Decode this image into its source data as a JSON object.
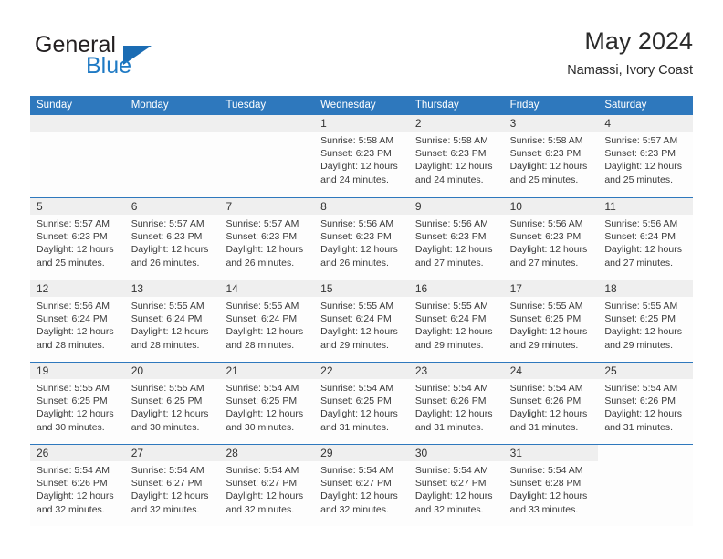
{
  "logo": {
    "word_top": "General",
    "word_bottom": "Blue",
    "triangle_icon": "triangle-icon",
    "color_dark": "#231f20",
    "color_blue": "#1f7ac4",
    "triangle_color": "#1b6cb3"
  },
  "header": {
    "title": "May 2024",
    "subtitle": "Namassi, Ivory Coast"
  },
  "theme": {
    "header_bar": "#2e78bd",
    "day_band": "#efefef",
    "row_divider": "#2e78bd",
    "text": "#3a3a3a"
  },
  "weekdays": [
    "Sunday",
    "Monday",
    "Tuesday",
    "Wednesday",
    "Thursday",
    "Friday",
    "Saturday"
  ],
  "weeks": [
    [
      {
        "day": "",
        "blank": false,
        "lines": []
      },
      {
        "day": "",
        "blank": false,
        "lines": []
      },
      {
        "day": "",
        "blank": false,
        "lines": []
      },
      {
        "day": "1",
        "blank": false,
        "lines": [
          "Sunrise: 5:58 AM",
          "Sunset: 6:23 PM",
          "Daylight: 12 hours",
          "and 24 minutes."
        ]
      },
      {
        "day": "2",
        "blank": false,
        "lines": [
          "Sunrise: 5:58 AM",
          "Sunset: 6:23 PM",
          "Daylight: 12 hours",
          "and 24 minutes."
        ]
      },
      {
        "day": "3",
        "blank": false,
        "lines": [
          "Sunrise: 5:58 AM",
          "Sunset: 6:23 PM",
          "Daylight: 12 hours",
          "and 25 minutes."
        ]
      },
      {
        "day": "4",
        "blank": false,
        "lines": [
          "Sunrise: 5:57 AM",
          "Sunset: 6:23 PM",
          "Daylight: 12 hours",
          "and 25 minutes."
        ]
      }
    ],
    [
      {
        "day": "5",
        "blank": false,
        "lines": [
          "Sunrise: 5:57 AM",
          "Sunset: 6:23 PM",
          "Daylight: 12 hours",
          "and 25 minutes."
        ]
      },
      {
        "day": "6",
        "blank": false,
        "lines": [
          "Sunrise: 5:57 AM",
          "Sunset: 6:23 PM",
          "Daylight: 12 hours",
          "and 26 minutes."
        ]
      },
      {
        "day": "7",
        "blank": false,
        "lines": [
          "Sunrise: 5:57 AM",
          "Sunset: 6:23 PM",
          "Daylight: 12 hours",
          "and 26 minutes."
        ]
      },
      {
        "day": "8",
        "blank": false,
        "lines": [
          "Sunrise: 5:56 AM",
          "Sunset: 6:23 PM",
          "Daylight: 12 hours",
          "and 26 minutes."
        ]
      },
      {
        "day": "9",
        "blank": false,
        "lines": [
          "Sunrise: 5:56 AM",
          "Sunset: 6:23 PM",
          "Daylight: 12 hours",
          "and 27 minutes."
        ]
      },
      {
        "day": "10",
        "blank": false,
        "lines": [
          "Sunrise: 5:56 AM",
          "Sunset: 6:23 PM",
          "Daylight: 12 hours",
          "and 27 minutes."
        ]
      },
      {
        "day": "11",
        "blank": false,
        "lines": [
          "Sunrise: 5:56 AM",
          "Sunset: 6:24 PM",
          "Daylight: 12 hours",
          "and 27 minutes."
        ]
      }
    ],
    [
      {
        "day": "12",
        "blank": false,
        "lines": [
          "Sunrise: 5:56 AM",
          "Sunset: 6:24 PM",
          "Daylight: 12 hours",
          "and 28 minutes."
        ]
      },
      {
        "day": "13",
        "blank": false,
        "lines": [
          "Sunrise: 5:55 AM",
          "Sunset: 6:24 PM",
          "Daylight: 12 hours",
          "and 28 minutes."
        ]
      },
      {
        "day": "14",
        "blank": false,
        "lines": [
          "Sunrise: 5:55 AM",
          "Sunset: 6:24 PM",
          "Daylight: 12 hours",
          "and 28 minutes."
        ]
      },
      {
        "day": "15",
        "blank": false,
        "lines": [
          "Sunrise: 5:55 AM",
          "Sunset: 6:24 PM",
          "Daylight: 12 hours",
          "and 29 minutes."
        ]
      },
      {
        "day": "16",
        "blank": false,
        "lines": [
          "Sunrise: 5:55 AM",
          "Sunset: 6:24 PM",
          "Daylight: 12 hours",
          "and 29 minutes."
        ]
      },
      {
        "day": "17",
        "blank": false,
        "lines": [
          "Sunrise: 5:55 AM",
          "Sunset: 6:25 PM",
          "Daylight: 12 hours",
          "and 29 minutes."
        ]
      },
      {
        "day": "18",
        "blank": false,
        "lines": [
          "Sunrise: 5:55 AM",
          "Sunset: 6:25 PM",
          "Daylight: 12 hours",
          "and 29 minutes."
        ]
      }
    ],
    [
      {
        "day": "19",
        "blank": false,
        "lines": [
          "Sunrise: 5:55 AM",
          "Sunset: 6:25 PM",
          "Daylight: 12 hours",
          "and 30 minutes."
        ]
      },
      {
        "day": "20",
        "blank": false,
        "lines": [
          "Sunrise: 5:55 AM",
          "Sunset: 6:25 PM",
          "Daylight: 12 hours",
          "and 30 minutes."
        ]
      },
      {
        "day": "21",
        "blank": false,
        "lines": [
          "Sunrise: 5:54 AM",
          "Sunset: 6:25 PM",
          "Daylight: 12 hours",
          "and 30 minutes."
        ]
      },
      {
        "day": "22",
        "blank": false,
        "lines": [
          "Sunrise: 5:54 AM",
          "Sunset: 6:25 PM",
          "Daylight: 12 hours",
          "and 31 minutes."
        ]
      },
      {
        "day": "23",
        "blank": false,
        "lines": [
          "Sunrise: 5:54 AM",
          "Sunset: 6:26 PM",
          "Daylight: 12 hours",
          "and 31 minutes."
        ]
      },
      {
        "day": "24",
        "blank": false,
        "lines": [
          "Sunrise: 5:54 AM",
          "Sunset: 6:26 PM",
          "Daylight: 12 hours",
          "and 31 minutes."
        ]
      },
      {
        "day": "25",
        "blank": false,
        "lines": [
          "Sunrise: 5:54 AM",
          "Sunset: 6:26 PM",
          "Daylight: 12 hours",
          "and 31 minutes."
        ]
      }
    ],
    [
      {
        "day": "26",
        "blank": false,
        "lines": [
          "Sunrise: 5:54 AM",
          "Sunset: 6:26 PM",
          "Daylight: 12 hours",
          "and 32 minutes."
        ]
      },
      {
        "day": "27",
        "blank": false,
        "lines": [
          "Sunrise: 5:54 AM",
          "Sunset: 6:27 PM",
          "Daylight: 12 hours",
          "and 32 minutes."
        ]
      },
      {
        "day": "28",
        "blank": false,
        "lines": [
          "Sunrise: 5:54 AM",
          "Sunset: 6:27 PM",
          "Daylight: 12 hours",
          "and 32 minutes."
        ]
      },
      {
        "day": "29",
        "blank": false,
        "lines": [
          "Sunrise: 5:54 AM",
          "Sunset: 6:27 PM",
          "Daylight: 12 hours",
          "and 32 minutes."
        ]
      },
      {
        "day": "30",
        "blank": false,
        "lines": [
          "Sunrise: 5:54 AM",
          "Sunset: 6:27 PM",
          "Daylight: 12 hours",
          "and 32 minutes."
        ]
      },
      {
        "day": "31",
        "blank": false,
        "lines": [
          "Sunrise: 5:54 AM",
          "Sunset: 6:28 PM",
          "Daylight: 12 hours",
          "and 33 minutes."
        ]
      },
      {
        "day": "",
        "blank": true,
        "lines": []
      }
    ]
  ]
}
